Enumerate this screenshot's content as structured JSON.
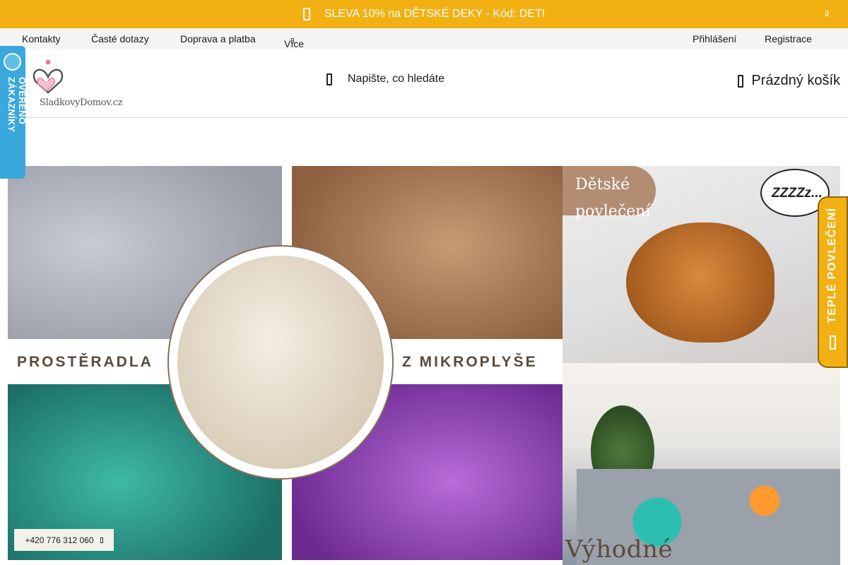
{
  "promo": {
    "text": "SLEVA 10% na DĚTSKÉ DEKY - Kód: DETI"
  },
  "topnav": {
    "items": [
      "Kontakty",
      "Časté dotazy",
      "Doprava a platba",
      "Více"
    ],
    "login": "Přihlášení",
    "register": "Registrace"
  },
  "header": {
    "logo_text": "SladkovyDomov.cz",
    "search_placeholder": "Napište, co hledáte",
    "cart_label": "Prázdný košík"
  },
  "left_badge": {
    "text": "OVĚŘENO ZÁKAZNÍKY"
  },
  "right_tab": {
    "text": "TEPLÉ POVLEČENÍ"
  },
  "banners": {
    "main_left": "PROSTĚRADLA",
    "main_right": "Z MIKROPLYŠE",
    "top_title_1": "Dětské",
    "top_title_2": "povlečení",
    "top_bubble": "ZZZZz...",
    "bottom_title": "Výhodné"
  },
  "contact": {
    "phone": "+420 776 312 060"
  },
  "colors": {
    "accent": "#f2b013",
    "badge_blue": "#3aa7dd",
    "brown": "#5b4a3a"
  }
}
